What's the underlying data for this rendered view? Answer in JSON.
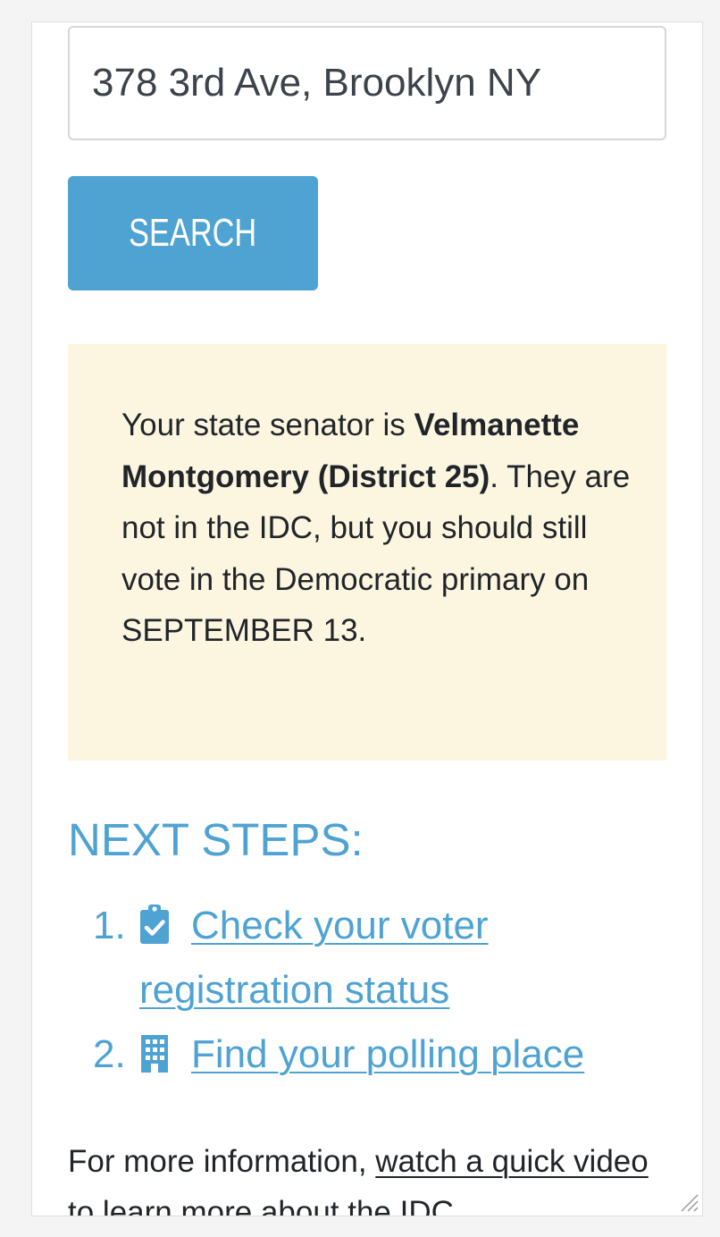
{
  "search": {
    "value": "378 3rd Ave, Brooklyn NY",
    "button_label": "SEARCH"
  },
  "result": {
    "intro": "Your state senator is",
    "senator_name": "Velmanette Montgomery",
    "district": "(District 25)",
    "message": ". They are not in the IDC, but you should still vote in the Democratic primary on SEPTEMBER 13."
  },
  "next_steps": {
    "title": "NEXT STEPS:",
    "items": [
      {
        "number": "1.",
        "icon": "clipboard-check-icon",
        "label": "Check your voter registration status"
      },
      {
        "number": "2.",
        "icon": "building-icon",
        "label": "Find your polling place"
      }
    ]
  },
  "more_info": {
    "prefix": "For more information, ",
    "link_text": "watch a quick video to learn more about the IDC"
  },
  "colors": {
    "accent": "#4ea3d3",
    "result_background": "#fcf6e1",
    "text": "#212529"
  }
}
